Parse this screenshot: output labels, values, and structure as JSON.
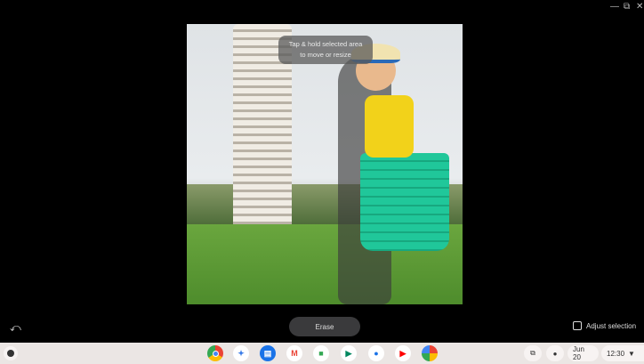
{
  "window_controls": [
    "minimize-icon",
    "restore-icon",
    "close-icon"
  ],
  "tooltip": {
    "line1": "Tap & hold selected area",
    "line2": "to move or resize"
  },
  "toolbar": {
    "undo_icon": "undo-icon",
    "erase_label": "Erase",
    "adjust_label": "Adjust selection"
  },
  "shelf": {
    "apps": [
      {
        "name": "Chrome",
        "color": "#4285f4"
      },
      {
        "name": "Gemini",
        "color": "#3b7de8"
      },
      {
        "name": "Files",
        "color": "#1a73e8"
      },
      {
        "name": "Gmail",
        "color": "#ea4335"
      },
      {
        "name": "Meet",
        "color": "#34a853"
      },
      {
        "name": "Play Store",
        "color": "#01875f"
      },
      {
        "name": "Messages",
        "color": "#1a73e8"
      },
      {
        "name": "YouTube",
        "color": "#ff0000"
      },
      {
        "name": "Photos",
        "color": "#fbbc04"
      }
    ],
    "date": "Jun 20",
    "time": "12:30"
  }
}
